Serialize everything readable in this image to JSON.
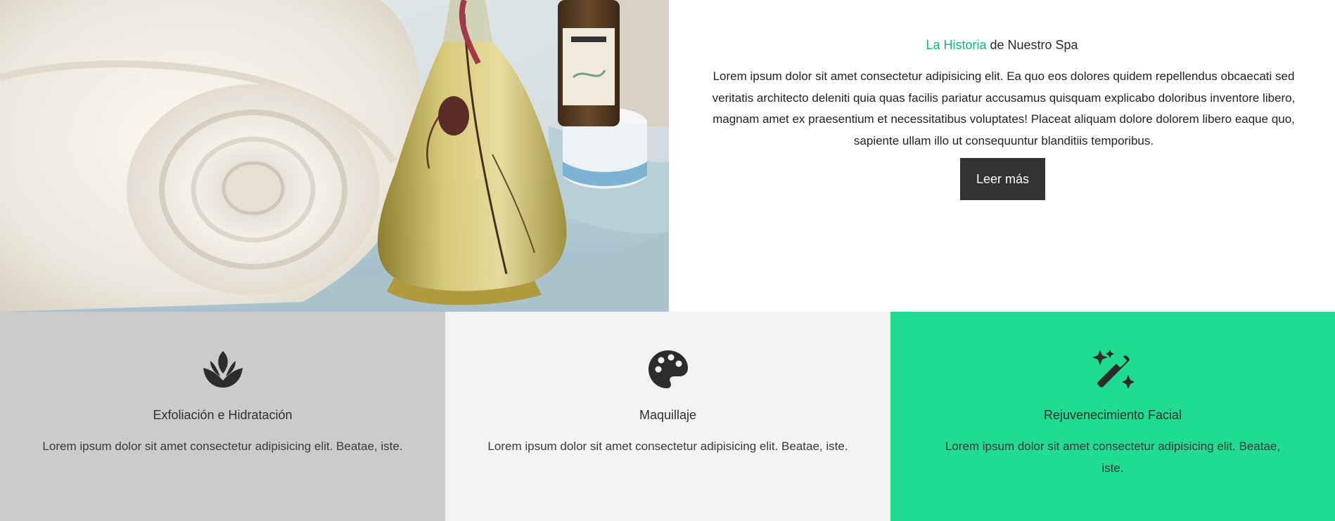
{
  "story": {
    "title_accent": "La Historia",
    "title_rest": " de Nuestro Spa",
    "text": "Lorem ipsum dolor sit amet consectetur adipisicing elit. Ea quo eos dolores quidem repellendus obcaecati sed veritatis architecto deleniti quia quas facilis pariatur accusamus quisquam explicabo doloribus inventore libero, magnam amet ex praesentium et necessitatibus voluptates! Placeat aliquam dolore dolorem libero eaque quo, sapiente ullam illo ut consequuntur blanditiis temporibus.",
    "button_label": "Leer más",
    "accent_color": "#14b780"
  },
  "services": [
    {
      "icon": "lotus-icon",
      "title": "Exfoliación e Hidratación",
      "text": "Lorem ipsum dolor sit amet consectetur adipisicing elit. Beatae, iste.",
      "background": "#cbcbcb"
    },
    {
      "icon": "palette-icon",
      "title": "Maquillaje",
      "text": "Lorem ipsum dolor sit amet consectetur adipisicing elit. Beatae, iste.",
      "background": "#f3f3f3"
    },
    {
      "icon": "magic-wand-sparkles-icon",
      "title": "Rejuvenecimiento Facial",
      "text": "Lorem ipsum dolor sit amet consectetur adipisicing elit. Beatae, iste.",
      "background": "#1fdc92"
    }
  ]
}
